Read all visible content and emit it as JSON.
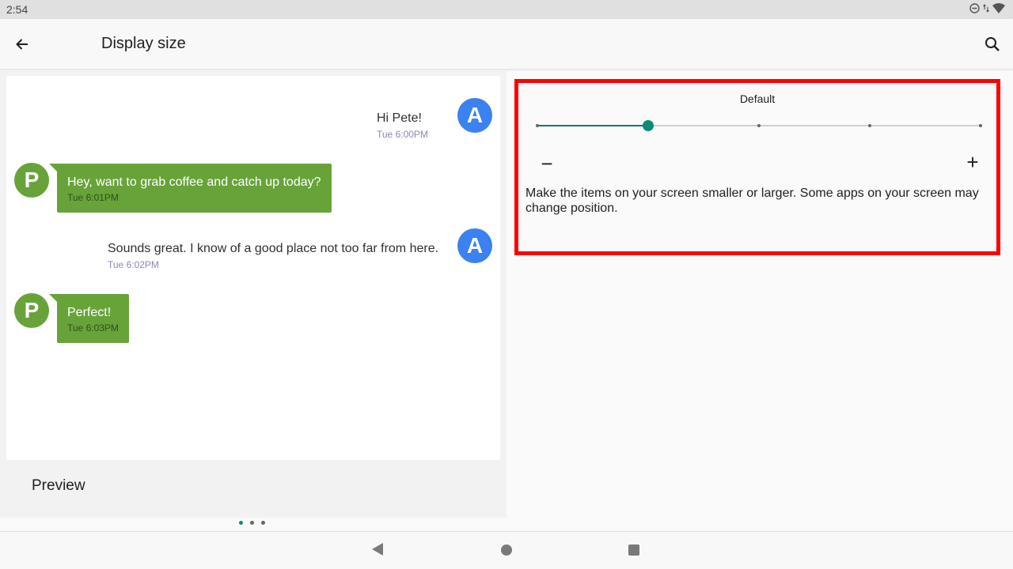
{
  "status_bar": {
    "time": "2:54"
  },
  "app_bar": {
    "title": "Display size",
    "icons": [
      "back-arrow-icon",
      "search-icon"
    ]
  },
  "preview": {
    "label": "Preview",
    "messages": [
      {
        "sender": "A",
        "text": "Hi Pete!",
        "time": "Tue 6:00PM"
      },
      {
        "sender": "P",
        "text": "Hey, want to grab coffee and catch up today?",
        "time": "Tue 6:01PM"
      },
      {
        "sender": "A",
        "text": "Sounds great. I know of a good place not too far from here.",
        "time": "Tue 6:02PM"
      },
      {
        "sender": "P",
        "text": "Perfect!",
        "time": "Tue 6:03PM"
      }
    ],
    "page_indicator": {
      "count": 3,
      "active": 0
    }
  },
  "settings": {
    "size_label": "Default",
    "slider": {
      "steps": 5,
      "selected_index": 1
    },
    "decrease_symbol": "−",
    "increase_symbol": "+",
    "description": "Make the items on your screen smaller or larger. Some apps on your screen may change position."
  },
  "colors": {
    "accent": "#0d8a78",
    "highlight_border": "#ff0000",
    "avatar_a": "#3b82f0",
    "avatar_p": "#68a33a"
  }
}
